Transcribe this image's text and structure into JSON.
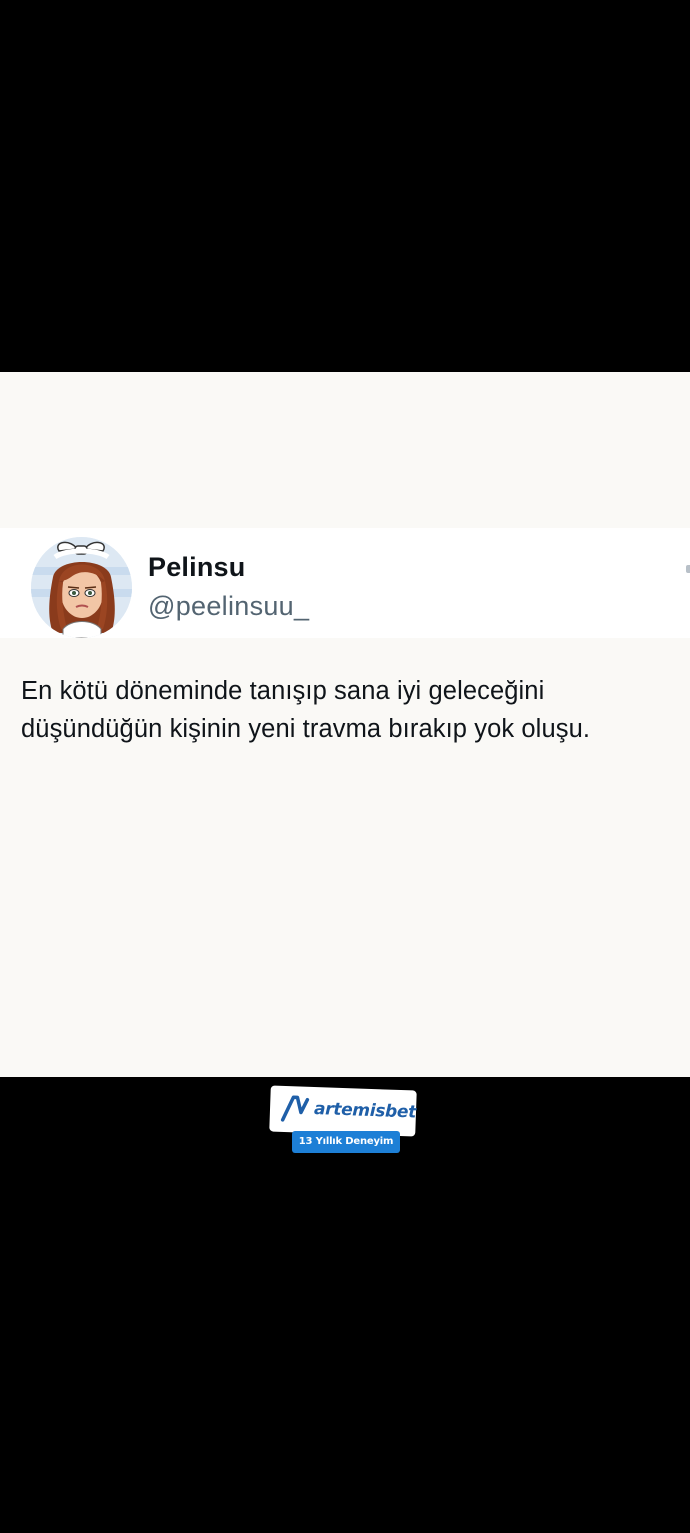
{
  "tweet": {
    "display_name": "Pelinsu",
    "handle": "@peelinsuu_",
    "text_line1": "En kötü döneminde tanışıp sana iyi geleceğini",
    "text_line2": "düşündüğün kişinin yeni travma bırakıp yok oluşu.",
    "avatar_icon": "cartoon-girl-avatar-icon"
  },
  "watermark": {
    "brand": "artemisbet",
    "tagline": "13 Yıllık Deneyim",
    "logo_icon": "artemisbet-logo-icon",
    "brand_color": "#1f5fa8",
    "badge_color": "#1d7fd6"
  },
  "colors": {
    "background_dark": "#000000",
    "card_background": "#faf9f6",
    "header_background": "#ffffff",
    "text_primary": "#0f1419",
    "text_secondary": "#536471"
  }
}
